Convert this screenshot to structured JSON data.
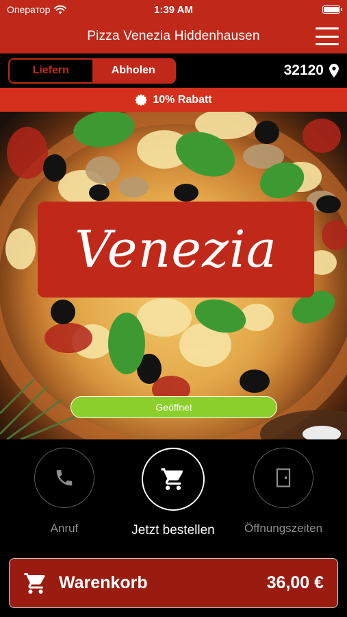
{
  "status": {
    "carrier": "Оператор",
    "time": "1:39 AM",
    "battery_level": 1.0
  },
  "header": {
    "title": "Pizza Venezia Hiddenhausen",
    "menu_icon": "hamburger-menu-icon"
  },
  "mode": {
    "delivery_label": "Liefern",
    "pickup_label": "Abholen",
    "selected": "pickup",
    "zip_code": "32120"
  },
  "promo": {
    "text": "10% Rabatt",
    "icon": "badge-icon"
  },
  "hero": {
    "logo_text": "Venezia",
    "status_label": "Geöffnet"
  },
  "actions": {
    "call_label": "Anruf",
    "order_label": "Jetzt bestellen",
    "hours_label": "Öffnungszeiten"
  },
  "cart": {
    "label": "Warenkorb",
    "total": "36,00 €"
  },
  "colors": {
    "brand_red": "#c0291a",
    "promo_red": "#d5301c",
    "cart_red": "#9a1c10",
    "open_green": "#8bd02a",
    "background": "#000000"
  }
}
